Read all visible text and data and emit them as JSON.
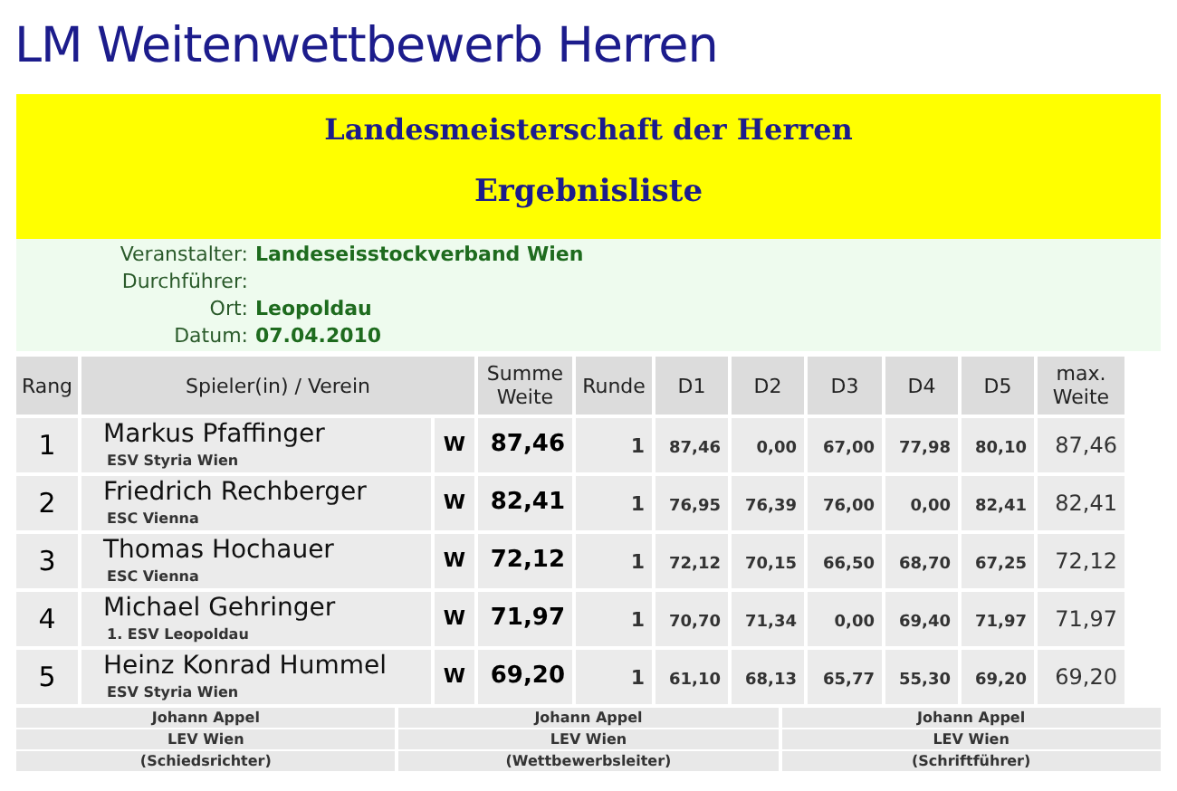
{
  "page_title": "LM Weitenwettbewerb Herren",
  "banner": {
    "title": "Landesmeisterschaft der Herren",
    "subtitle": "Ergebnisliste"
  },
  "info": [
    {
      "label": "Veranstalter:",
      "value": "Landeseisstockverband Wien"
    },
    {
      "label": "Durchführer:"
    },
    {
      "label": "Ort:",
      "value": "Leopoldau"
    },
    {
      "label": "Datum:",
      "value": "07.04.2010"
    }
  ],
  "table": {
    "columns": [
      "Rang",
      "Spieler(in) / Verein",
      "Summe Weite",
      "Runde",
      "D1",
      "D2",
      "D3",
      "D4",
      "D5",
      "max. Weite"
    ],
    "rows": [
      {
        "rank": "1",
        "name": "Markus Pfaffinger",
        "club": "ESV Styria Wien",
        "mark": "W",
        "total": "87,46",
        "round": "1",
        "throws": [
          "87,46",
          "0,00",
          "67,00",
          "77,98",
          "80,10"
        ],
        "max": "87,46"
      },
      {
        "rank": "2",
        "name": "Friedrich Rechberger",
        "club": "ESC Vienna",
        "mark": "W",
        "total": "82,41",
        "round": "1",
        "throws": [
          "76,95",
          "76,39",
          "76,00",
          "0,00",
          "82,41"
        ],
        "max": "82,41"
      },
      {
        "rank": "3",
        "name": "Thomas Hochauer",
        "club": "ESC Vienna",
        "mark": "W",
        "total": "72,12",
        "round": "1",
        "throws": [
          "72,12",
          "70,15",
          "66,50",
          "68,70",
          "67,25"
        ],
        "max": "72,12"
      },
      {
        "rank": "4",
        "name": "Michael Gehringer",
        "club": "1. ESV Leopoldau",
        "mark": "W",
        "total": "71,97",
        "round": "1",
        "throws": [
          "70,70",
          "71,34",
          "0,00",
          "69,40",
          "71,97"
        ],
        "max": "71,97"
      },
      {
        "rank": "5",
        "name": "Heinz Konrad Hummel",
        "club": "ESV Styria Wien",
        "mark": "W",
        "total": "69,20",
        "round": "1",
        "throws": [
          "61,10",
          "68,13",
          "65,77",
          "55,30",
          "69,20"
        ],
        "max": "69,20"
      }
    ]
  },
  "officials": [
    {
      "name": "Johann Appel",
      "club": "LEV Wien",
      "role": "(Schiedsrichter)"
    },
    {
      "name": "Johann Appel",
      "club": "LEV Wien",
      "role": "(Wettbewerbsleiter)"
    },
    {
      "name": "Johann Appel",
      "club": "LEV Wien",
      "role": "(Schriftführer)"
    }
  ]
}
